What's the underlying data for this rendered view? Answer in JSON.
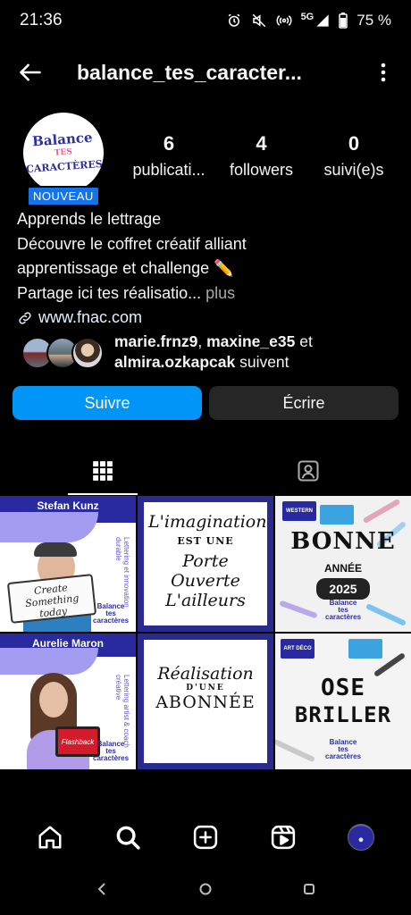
{
  "status_bar": {
    "time": "21:36",
    "network": "5G",
    "battery": "75 %"
  },
  "header": {
    "title": "balance_tes_caracter..."
  },
  "profile": {
    "avatar_logo_top": "Balance",
    "avatar_logo_mid": "TES",
    "avatar_logo_bottom": "CARACTÈRES",
    "badge": "NOUVEAU",
    "stats": [
      {
        "value": "6",
        "label": "publicati..."
      },
      {
        "value": "4",
        "label": "followers"
      },
      {
        "value": "0",
        "label": "suivi(e)s"
      }
    ]
  },
  "bio": {
    "line1": "Apprends le lettrage",
    "line2": "Découvre le coffret créatif alliant",
    "line3": "apprentissage et challenge ✏️",
    "line4": "Partage ici tes réalisatio...",
    "more": "plus",
    "link": "www.fnac.com"
  },
  "followed_by": {
    "user1": "marie.frnz9",
    "sep1": ", ",
    "user2": "maxine_e35",
    "and": " et",
    "user3": "almira.ozkapcak",
    "suffix": " suivent"
  },
  "actions": {
    "follow": "Suivre",
    "message": "Écrire"
  },
  "posts": {
    "p1": {
      "name": "Stefan Kunz",
      "sign": "Create Something today",
      "side": "Lettering et innovation durable",
      "logo": "Balance tes caractères"
    },
    "p2": {
      "line1": "L'imagination",
      "line2": "EST UNE",
      "line3": "Porte Ouverte",
      "line4": "L'ailleurs"
    },
    "p3": {
      "tag1": "WESTERN",
      "tag2": "",
      "title": "BONNE",
      "subtitle": "ANNÉE",
      "year": "2025",
      "logo": "Balance tes caractères"
    },
    "p4": {
      "name": "Aurelie Maron",
      "sign": "Flashback",
      "side": "Lettering artist & coach créative",
      "logo": "Balance tes caractères"
    },
    "p5": {
      "line1": "Réalisation",
      "line2": "D'UNE",
      "line3": "ABONNÉE"
    },
    "p6": {
      "tag": "ART DÉCO",
      "line1": "OSE",
      "line2": "BRILLER",
      "logo": "Balance tes caractères"
    }
  },
  "colors": {
    "follow_button": "#0095f6",
    "message_button": "#262626",
    "badge": "#1473e6",
    "brand_blue": "#2a2aa0",
    "brand_lilac": "#a39cf0"
  },
  "icons": {
    "back": "arrow-left-icon",
    "more": "kebab-icon",
    "link": "link-icon",
    "grid": "grid-icon",
    "tagged": "tagged-icon",
    "home": "home-icon",
    "search": "search-icon",
    "create": "plus-square-icon",
    "reels": "reels-icon"
  }
}
